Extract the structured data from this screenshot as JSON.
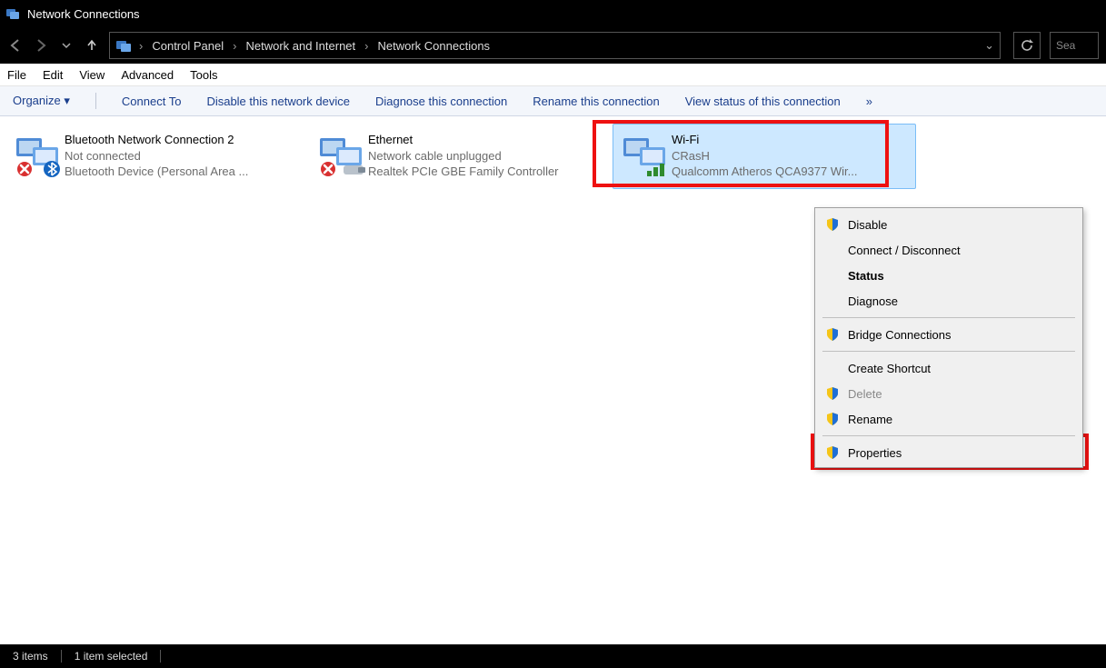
{
  "title": "Network Connections",
  "breadcrumbs": [
    "Control Panel",
    "Network and Internet",
    "Network Connections"
  ],
  "search_placeholder": "Sea",
  "menu": {
    "file": "File",
    "edit": "Edit",
    "view": "View",
    "advanced": "Advanced",
    "tools": "Tools"
  },
  "toolbar": {
    "organize": "Organize",
    "connect_to": "Connect To",
    "disable": "Disable this network device",
    "diagnose": "Diagnose this connection",
    "rename": "Rename this connection",
    "view_status": "View status of this connection",
    "more": "»"
  },
  "items": [
    {
      "name": "Bluetooth Network Connection 2",
      "status": "Not connected",
      "device": "Bluetooth Device (Personal Area ...",
      "kind": "bluetooth",
      "state": "error"
    },
    {
      "name": "Ethernet",
      "status": "Network cable unplugged",
      "device": "Realtek PCIe GBE Family Controller",
      "kind": "ethernet",
      "state": "error"
    },
    {
      "name": "Wi-Fi",
      "status": "CRasH",
      "device": "Qualcomm Atheros QCA9377 Wir...",
      "kind": "wifi",
      "state": "ok",
      "selected": true
    }
  ],
  "context_menu": {
    "disable": "Disable",
    "connect_disconnect": "Connect / Disconnect",
    "status": "Status",
    "diagnose": "Diagnose",
    "bridge": "Bridge Connections",
    "create_shortcut": "Create Shortcut",
    "delete": "Delete",
    "rename": "Rename",
    "properties": "Properties"
  },
  "statusbar": {
    "count": "3 items",
    "selected": "1 item selected"
  }
}
